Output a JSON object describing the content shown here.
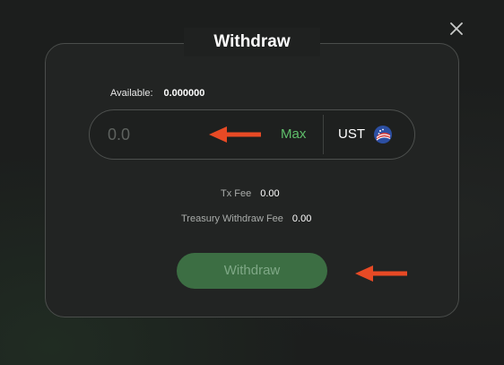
{
  "dialog": {
    "title": "Withdraw",
    "close_icon": "close-icon"
  },
  "available": {
    "label": "Available:",
    "value": "0.000000"
  },
  "amount": {
    "placeholder": "0.0",
    "value": "",
    "max_label": "Max",
    "token_symbol": "UST",
    "token_icon": "ust-token-icon"
  },
  "fees": {
    "tx_fee_label": "Tx Fee",
    "tx_fee_value": "0.00",
    "treasury_fee_label": "Treasury Withdraw Fee",
    "treasury_fee_value": "0.00"
  },
  "actions": {
    "withdraw_label": "Withdraw"
  },
  "annotations": {
    "arrow_icon": "red-arrow-left-icon",
    "arrow_color": "#e84a25"
  },
  "colors": {
    "accent": "#5fbf6b",
    "button_bg": "#3c6e43",
    "button_text": "#7fa886",
    "panel_bg": "#222423",
    "panel_border": "#4a4d4b"
  }
}
